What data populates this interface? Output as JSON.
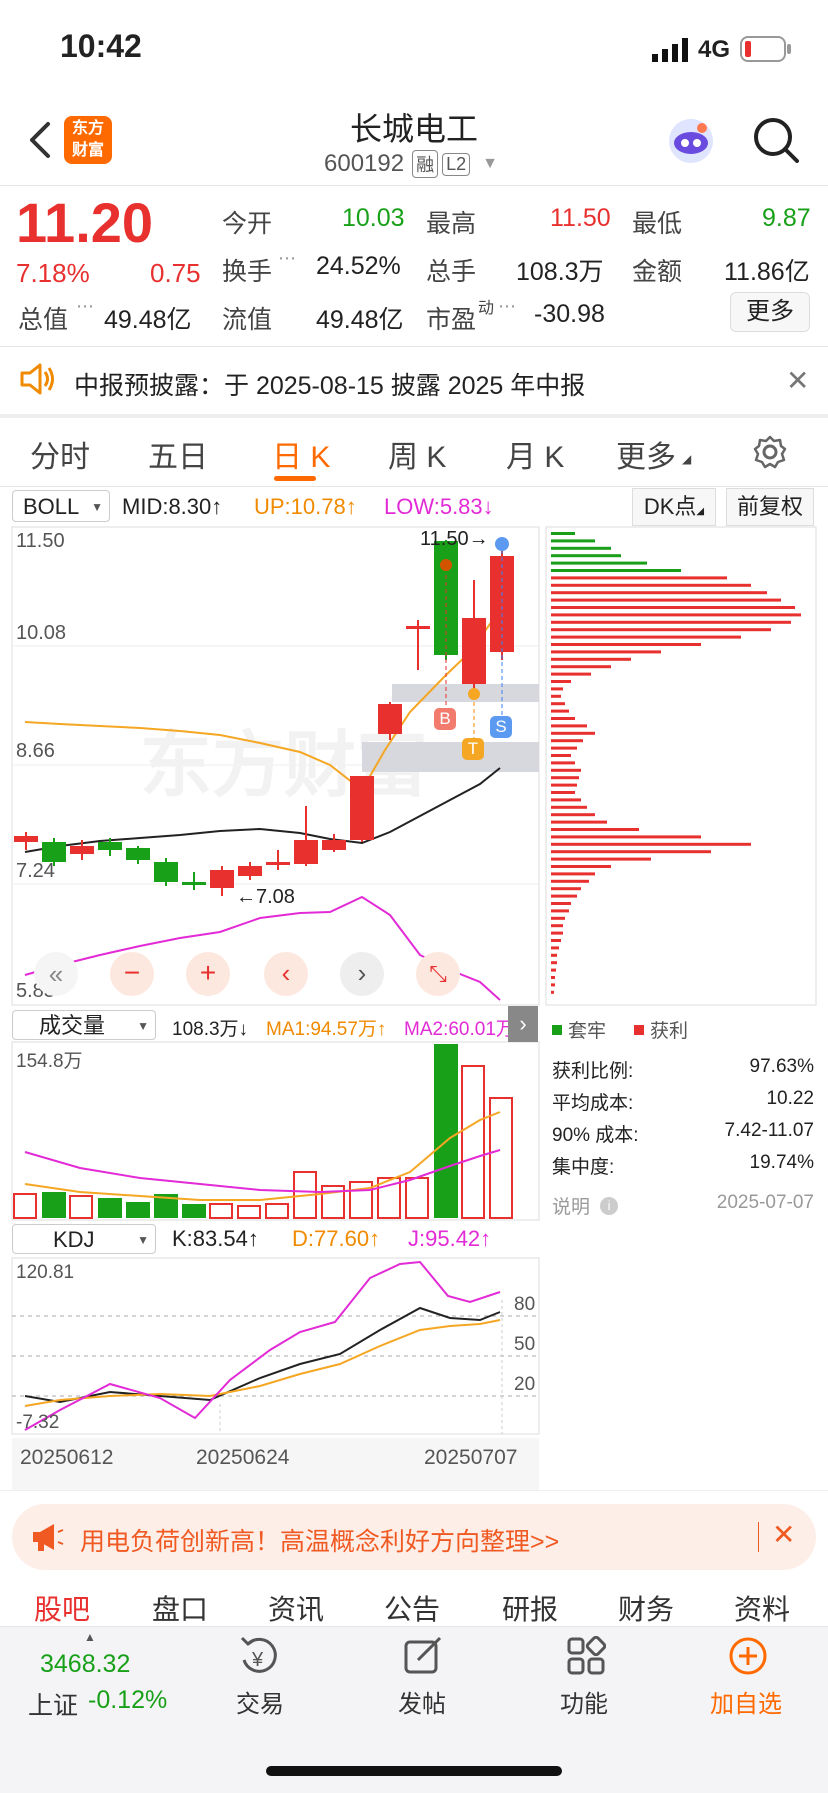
{
  "status_bar": {
    "time": "10:42",
    "network": "4G"
  },
  "header": {
    "title": "长城电工",
    "code": "600192",
    "badge_margin": "融",
    "badge_level": "L2",
    "logo_line1": "东方",
    "logo_line2": "财富"
  },
  "quote": {
    "price": "11.20",
    "change_pct": "7.18%",
    "change": "0.75",
    "open_label": "今开",
    "open": "10.03",
    "high_label": "最高",
    "high": "11.50",
    "low_label": "最低",
    "low": "9.87",
    "turnover_label": "换手",
    "turnover": "24.52%",
    "volume_label": "总手",
    "volume": "108.3万",
    "amount_label": "金额",
    "amount": "11.86亿",
    "mktcap_label": "总值",
    "mktcap": "49.48亿",
    "float_label": "流值",
    "float": "49.48亿",
    "pe_label": "市盈",
    "pe_sup": "动",
    "pe": "-30.98",
    "more_button": "更多"
  },
  "notice": {
    "text": "中报预披露：于 2025-08-15 披露 2025 年中报"
  },
  "tabs": [
    "分时",
    "五日",
    "日 K",
    "周 K",
    "月 K",
    "更多"
  ],
  "indicator_bar": {
    "name": "BOLL",
    "mid": "MID:8.30",
    "up": "UP:10.78",
    "low": "LOW:5.83",
    "dk_button": "DK点",
    "adjust_button": "前复权"
  },
  "kline": {
    "y_labels": [
      "11.50",
      "10.08",
      "8.66",
      "7.24",
      "5.83"
    ],
    "high_marker": "11.50",
    "low_marker": "7.08",
    "signals": {
      "b": "B",
      "t": "T",
      "s": "S"
    }
  },
  "volume_bar": {
    "name": "成交量",
    "value": "108.3万",
    "ma1": "MA1:94.57万",
    "ma2": "MA2:60.01万",
    "max_label": "154.8万"
  },
  "kdj_bar": {
    "name": "KDJ",
    "k": "K:83.54",
    "d": "D:77.60",
    "j": "J:95.42",
    "max_label": "120.81",
    "min_label": "-7.32",
    "levels": [
      "80",
      "50",
      "20"
    ]
  },
  "dates": [
    "20250612",
    "20250624",
    "20250707"
  ],
  "chip": {
    "legend_trapped": "套牢",
    "legend_profit": "获利",
    "rows": [
      {
        "label": "获利比例:",
        "value": "97.63%"
      },
      {
        "label": "平均成本:",
        "value": "10.22"
      },
      {
        "label": "90% 成本:",
        "value": "7.42-11.07"
      },
      {
        "label": "集中度:",
        "value": "19.74%"
      }
    ],
    "note_label": "说明",
    "note_date": "2025-07-07"
  },
  "ad_banner": {
    "text": "用电负荷创新高！高温概念利好方向整理>>"
  },
  "section_tabs": [
    "股吧",
    "盘口",
    "资讯",
    "公告",
    "研报",
    "财务",
    "资料"
  ],
  "bottom_nav": {
    "index_value": "3468.32",
    "index_name": "上证",
    "index_change": "-0.12%",
    "items": [
      "交易",
      "发帖",
      "功能",
      "加自选"
    ]
  },
  "colors": {
    "red": "#e8312f",
    "green": "#19a019",
    "orange": "#f08a00",
    "magenta": "#e22ad6",
    "brand": "#ff6a00"
  }
}
